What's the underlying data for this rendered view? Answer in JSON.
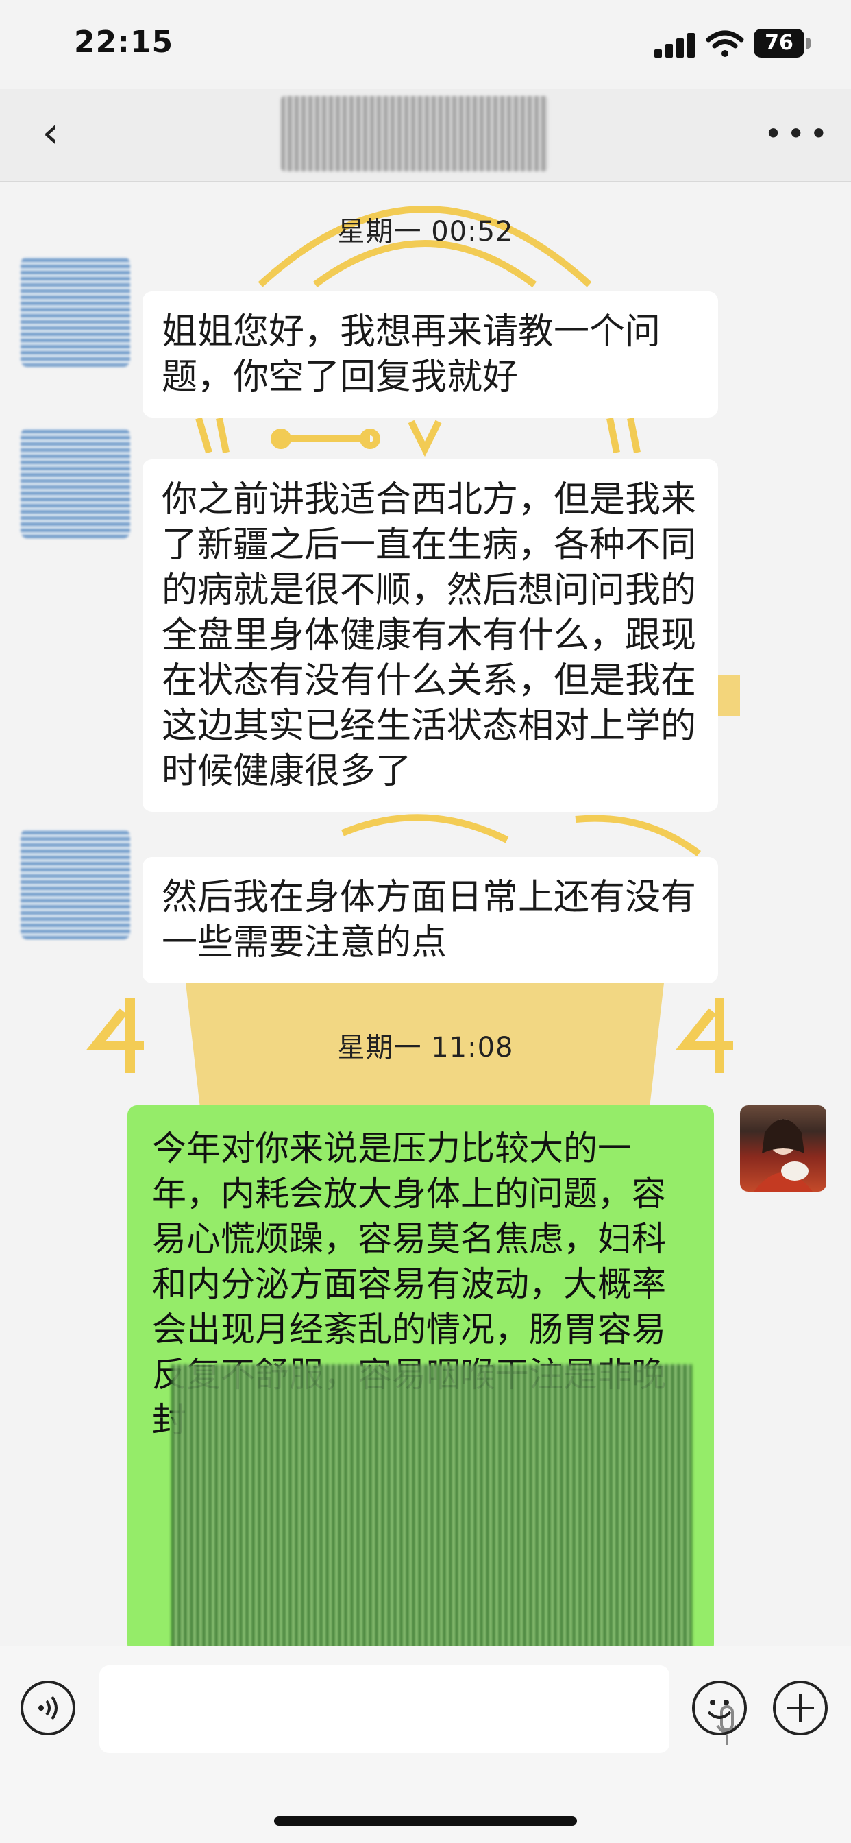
{
  "status_bar": {
    "time": "22:15",
    "battery": "76"
  },
  "nav": {
    "back_label": "‹",
    "more_label": "•••"
  },
  "chat": {
    "timestamp_1": "星期一 00:52",
    "messages_left": [
      {
        "text": "姐姐您好，我想再来请教一个问题，你空了回复我就好"
      },
      {
        "text": "你之前讲我适合西北方，但是我来了新疆之后一直在生病，各种不同的病就是很不顺，然后想问问我的全盘里身体健康有木有什么，跟现在状态有没有什么关系，但是我在这边其实已经生活状态相对上学的时候健康很多了"
      },
      {
        "text": "然后我在身体方面日常上还有没有一些需要注意的点"
      }
    ],
    "timestamp_2": "星期一 11:08",
    "messages_right": [
      {
        "text": "今年对你来说是压力比较大的一年，内耗会放大身体上的问题，容易心慌烦躁，容易莫名焦虑，妇科和内分泌方面容易有波动，大概率会出现月经紊乱的情况，肠胃容易反复不舒服，容易咽喉干注是非晚封"
      }
    ]
  },
  "colors": {
    "bubble_right": "#95ec69",
    "bubble_left": "#ffffff",
    "decoration_gold": "#f2c94c"
  },
  "icons": [
    "back-icon",
    "more-icon",
    "voice-icon",
    "mic-icon",
    "emoji-icon",
    "plus-icon"
  ]
}
